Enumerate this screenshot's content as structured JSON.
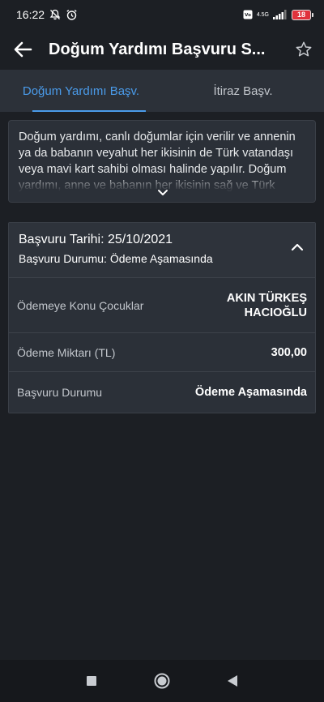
{
  "status_bar": {
    "time": "16:22",
    "network_top": "4.5G",
    "network_volte": "VoLTE",
    "battery": "18"
  },
  "header": {
    "title": "Doğum Yardımı Başvuru S...",
    "back_icon": "arrow-left-icon",
    "star_icon": "star-outline-icon"
  },
  "tabs": [
    {
      "label": "Doğum Yardımı Başv.",
      "active": true
    },
    {
      "label": "İtiraz Başv.",
      "active": false
    }
  ],
  "info": {
    "text": "Doğum yardımı, canlı doğumlar için verilir ve annenin ya da babanın veyahut her ikisinin de Türk vatandaşı veya mavi kart sahibi olması halinde yapılır. Doğum yardımı, anne ve babanın her ikisinin sağ ve Türk"
  },
  "application": {
    "date_line": "Başvuru Tarihi: 25/10/2021",
    "status_line": "Başvuru Durumu: Ödeme Aşamasında",
    "rows": [
      {
        "label": "Ödemeye Konu Çocuklar",
        "value_line1": "AKIN TÜRKEŞ",
        "value_line2": "HACIOĞLU"
      },
      {
        "label": "Ödeme Miktarı (TL)",
        "value": "300,00"
      },
      {
        "label": "Başvuru Durumu",
        "value": "Ödeme Aşamasında"
      }
    ]
  },
  "colors": {
    "background": "#1c1f24",
    "card": "#2b3038",
    "tab_bar": "#2c3139",
    "accent": "#4a9bea"
  }
}
